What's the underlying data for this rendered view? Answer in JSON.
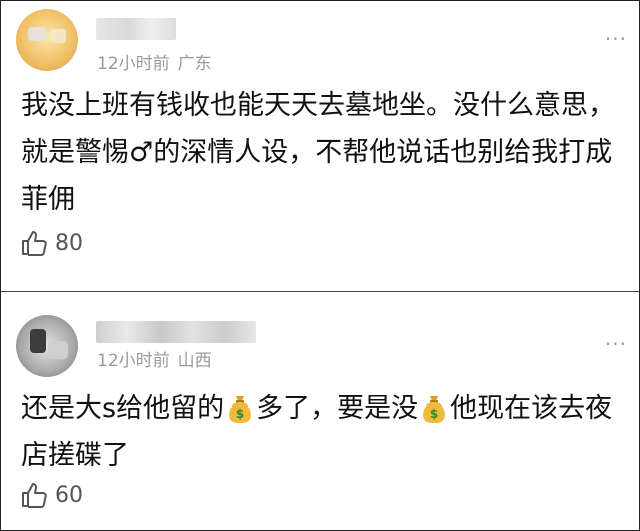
{
  "comments": [
    {
      "username": "",
      "time": "12小时前",
      "location": "广东",
      "text": "我没上班有钱收也能天天去墓地坐。没什么意思，就是警惕♂的深情人设，不帮他说话也别给我打成菲佣",
      "likes": "80",
      "more": "···"
    },
    {
      "username": "",
      "time": "12小时前",
      "location": "山西",
      "text_part1": "还是大s给他留的",
      "text_part2": "多了，要是没",
      "text_part3": "他现在该去夜店搓碟了",
      "likes": "60",
      "more": "···"
    }
  ],
  "icons": {
    "like": "thumbs-up-icon",
    "more": "more-options-icon",
    "emoji": "money-bag-emoji"
  },
  "colors": {
    "meta_text": "#9a9a9a",
    "body_text": "#111111",
    "border": "#222222"
  }
}
